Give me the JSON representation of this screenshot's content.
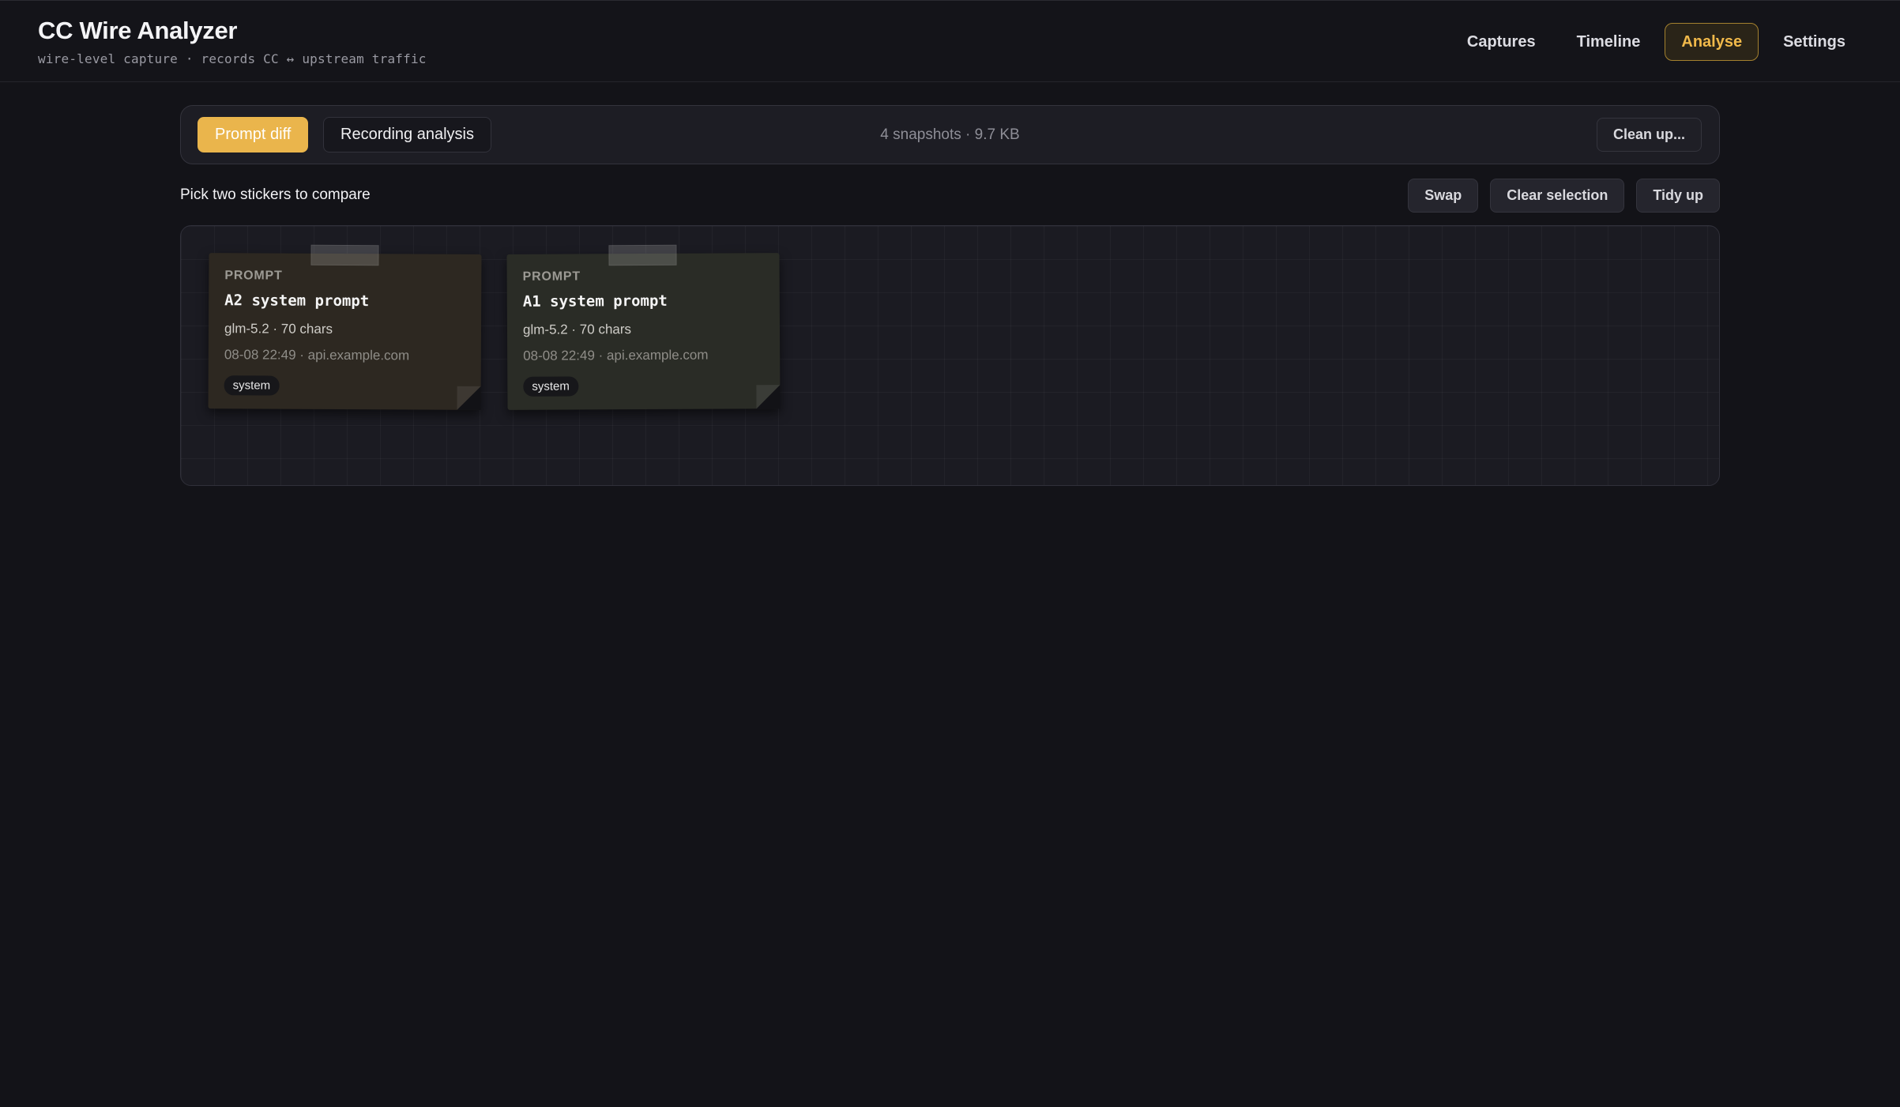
{
  "app": {
    "title": "CC Wire Analyzer",
    "subtitle": "wire-level capture · records CC ↔ upstream traffic"
  },
  "nav": {
    "items": [
      {
        "label": "Captures",
        "active": false
      },
      {
        "label": "Timeline",
        "active": false
      },
      {
        "label": "Analyse",
        "active": true
      },
      {
        "label": "Settings",
        "active": false
      }
    ]
  },
  "toolbar": {
    "tabs": [
      {
        "label": "Prompt diff",
        "active": true
      },
      {
        "label": "Recording analysis",
        "active": false
      }
    ],
    "stats": "4 snapshots · 9.7 KB",
    "cleanup_label": "Clean up..."
  },
  "compare": {
    "hint": "Pick two stickers to compare",
    "swap_label": "Swap",
    "clear_label": "Clear selection",
    "tidy_label": "Tidy up"
  },
  "stickers": [
    {
      "kind": "PROMPT",
      "title": "A2 system prompt",
      "meta": "glm-5.2 · 70 chars",
      "time": "08-08 22:49 · api.example.com",
      "tag": "system"
    },
    {
      "kind": "PROMPT",
      "title": "A1 system prompt",
      "meta": "glm-5.2 · 70 chars",
      "time": "08-08 22:49 · api.example.com",
      "tag": "system"
    }
  ],
  "colors": {
    "accent": "#eab54c",
    "background": "#131318",
    "panel": "#1d1d24"
  }
}
